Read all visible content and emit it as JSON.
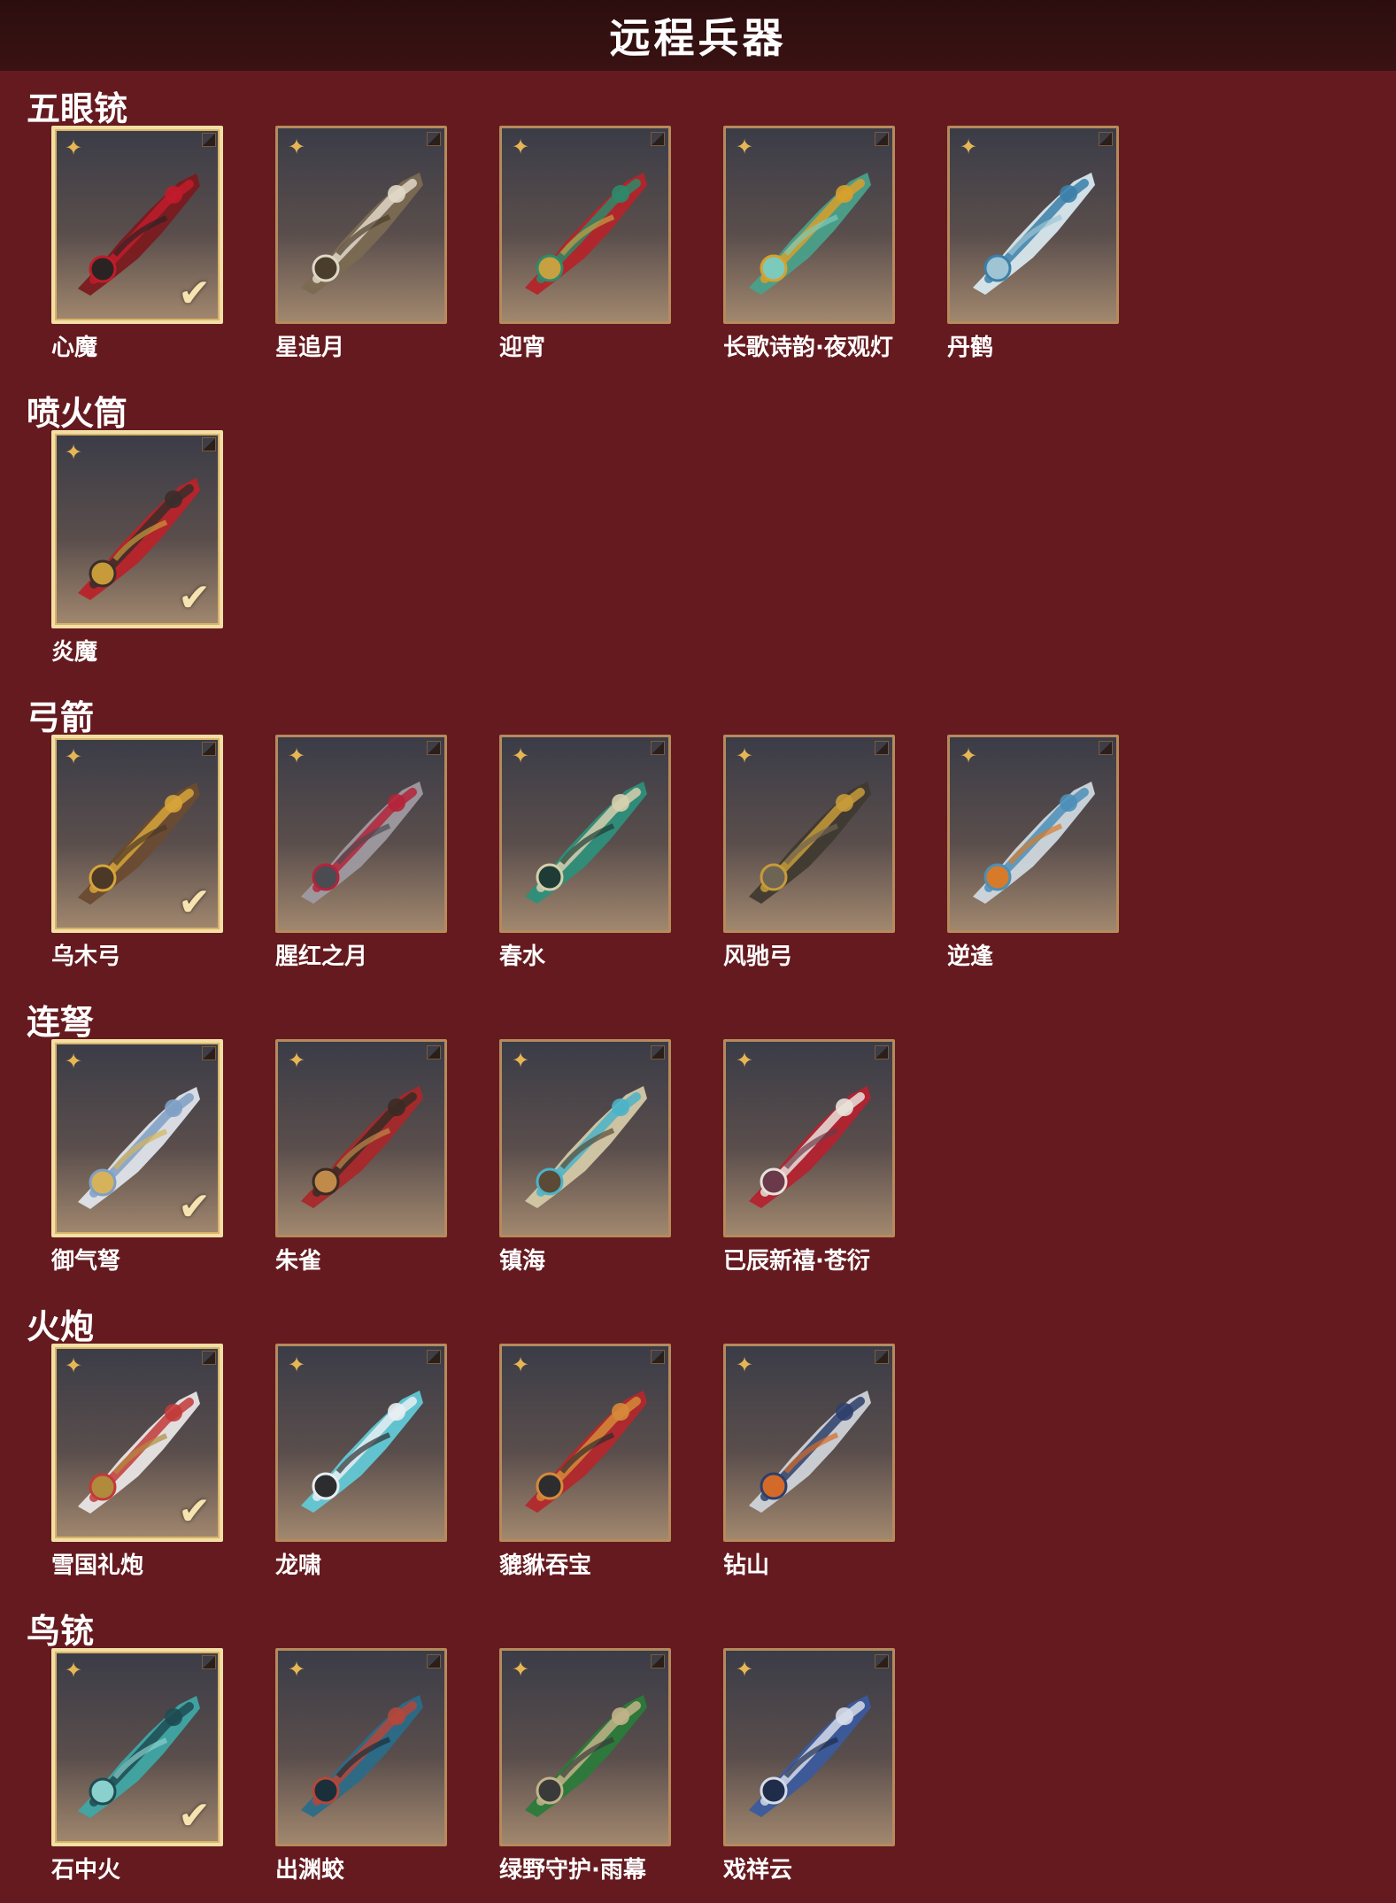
{
  "header": {
    "title": "远程兵器"
  },
  "colors": {
    "background": "#651a1f",
    "header": "#2c0e0f",
    "card_border": "#b58a5c",
    "selected_border": "#f3dfa5",
    "star": "#e6b655"
  },
  "sections": [
    {
      "title": "五眼铳",
      "items": [
        {
          "label": "心魔",
          "selected": true,
          "palette": [
            "#7a1a1f",
            "#c01c2a",
            "#2a2323"
          ]
        },
        {
          "label": "星追月",
          "selected": false,
          "palette": [
            "#7b6a52",
            "#e0d7c8",
            "#4b3d2b"
          ]
        },
        {
          "label": "迎宵",
          "selected": false,
          "palette": [
            "#b3252a",
            "#2e8a6b",
            "#c7a042"
          ]
        },
        {
          "label": "长歌诗韵·夜观灯",
          "selected": false,
          "palette": [
            "#4aa08a",
            "#d7a02c",
            "#7ccabc"
          ]
        },
        {
          "label": "丹鹤",
          "selected": false,
          "palette": [
            "#d8e8ee",
            "#3b7fa8",
            "#9fc4d4"
          ]
        }
      ]
    },
    {
      "title": "喷火筒",
      "items": [
        {
          "label": "炎魔",
          "selected": true,
          "palette": [
            "#b8232a",
            "#3a2e2b",
            "#c79b3a"
          ]
        }
      ]
    },
    {
      "title": "弓箭",
      "items": [
        {
          "label": "乌木弓",
          "selected": true,
          "palette": [
            "#6a4b32",
            "#d6a43a",
            "#4b3826"
          ]
        },
        {
          "label": "腥红之月",
          "selected": false,
          "palette": [
            "#9e9aa0",
            "#b3243a",
            "#4b4b52"
          ]
        },
        {
          "label": "春水",
          "selected": false,
          "palette": [
            "#2e8f7a",
            "#d6cfae",
            "#1f3b35"
          ]
        },
        {
          "label": "风驰弓",
          "selected": false,
          "palette": [
            "#3f3a30",
            "#c79b3a",
            "#6e6454"
          ]
        },
        {
          "label": "逆逢",
          "selected": false,
          "palette": [
            "#cfd8de",
            "#4c8fb8",
            "#d77a2a"
          ]
        }
      ]
    },
    {
      "title": "连弩",
      "items": [
        {
          "label": "御气弩",
          "selected": true,
          "palette": [
            "#dfe4ea",
            "#7f9fc4",
            "#d6b35a"
          ]
        },
        {
          "label": "朱雀",
          "selected": false,
          "palette": [
            "#a8282a",
            "#3a2b25",
            "#c08a4a"
          ]
        },
        {
          "label": "镇海",
          "selected": false,
          "palette": [
            "#d4c9a6",
            "#4bb3c8",
            "#5a4a36"
          ]
        },
        {
          "label": "已辰新禧·苍衍",
          "selected": false,
          "palette": [
            "#b3232f",
            "#e8e2dc",
            "#6b3a4a"
          ]
        }
      ]
    },
    {
      "title": "火炮",
      "items": [
        {
          "label": "雪国礼炮",
          "selected": true,
          "palette": [
            "#e9e6e6",
            "#c23a3a",
            "#b08b3c"
          ]
        },
        {
          "label": "龙啸",
          "selected": false,
          "palette": [
            "#62c9d6",
            "#e8eef2",
            "#2d2d2f"
          ]
        },
        {
          "label": "貔貅吞宝",
          "selected": false,
          "palette": [
            "#b3282c",
            "#d58a3a",
            "#2d2d2f"
          ]
        },
        {
          "label": "钻山",
          "selected": false,
          "palette": [
            "#cfd3d8",
            "#2d3f6a",
            "#d46a2a"
          ]
        }
      ]
    },
    {
      "title": "鸟铳",
      "items": [
        {
          "label": "石中火",
          "selected": true,
          "palette": [
            "#3fa6a4",
            "#1f4b52",
            "#8ad0cc"
          ]
        },
        {
          "label": "出渊蛟",
          "selected": false,
          "palette": [
            "#2b6b88",
            "#b4473a",
            "#1b2f3a"
          ]
        },
        {
          "label": "绿野守护·雨幕",
          "selected": false,
          "palette": [
            "#2b7a3a",
            "#c2b38a",
            "#3a3a3a"
          ]
        },
        {
          "label": "戏祥云",
          "selected": false,
          "palette": [
            "#3b5a9c",
            "#d6dbe8",
            "#1f2c4a"
          ]
        }
      ]
    }
  ],
  "icons": {
    "rank": "star-rank-icon",
    "selected": "check-icon",
    "corner": "corner-tag-icon"
  }
}
